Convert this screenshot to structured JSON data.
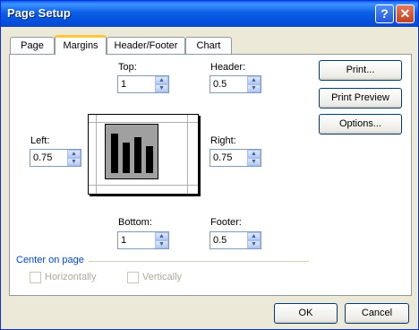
{
  "window": {
    "title": "Page Setup",
    "help_label": "?",
    "close_label": "✕"
  },
  "tabs": [
    {
      "label": "Page",
      "active": false
    },
    {
      "label": "Margins",
      "active": true
    },
    {
      "label": "Header/Footer",
      "active": false
    },
    {
      "label": "Chart",
      "active": false
    }
  ],
  "margins": {
    "top": {
      "label": "Top:",
      "value": "1"
    },
    "header": {
      "label": "Header:",
      "value": "0.5"
    },
    "left": {
      "label": "Left:",
      "value": "0.75"
    },
    "right": {
      "label": "Right:",
      "value": "0.75"
    },
    "bottom": {
      "label": "Bottom:",
      "value": "1"
    },
    "footer": {
      "label": "Footer:",
      "value": "0.5"
    }
  },
  "buttons": {
    "print": "Print...",
    "print_preview": "Print Preview",
    "options": "Options...",
    "ok": "OK",
    "cancel": "Cancel"
  },
  "center_on_page": {
    "label": "Center on page",
    "horizontally": {
      "label": "Horizontally",
      "checked": false,
      "enabled": false
    },
    "vertically": {
      "label": "Vertically",
      "checked": false,
      "enabled": false
    }
  },
  "icons": {
    "spin_up": "▲",
    "spin_down": "▼"
  }
}
